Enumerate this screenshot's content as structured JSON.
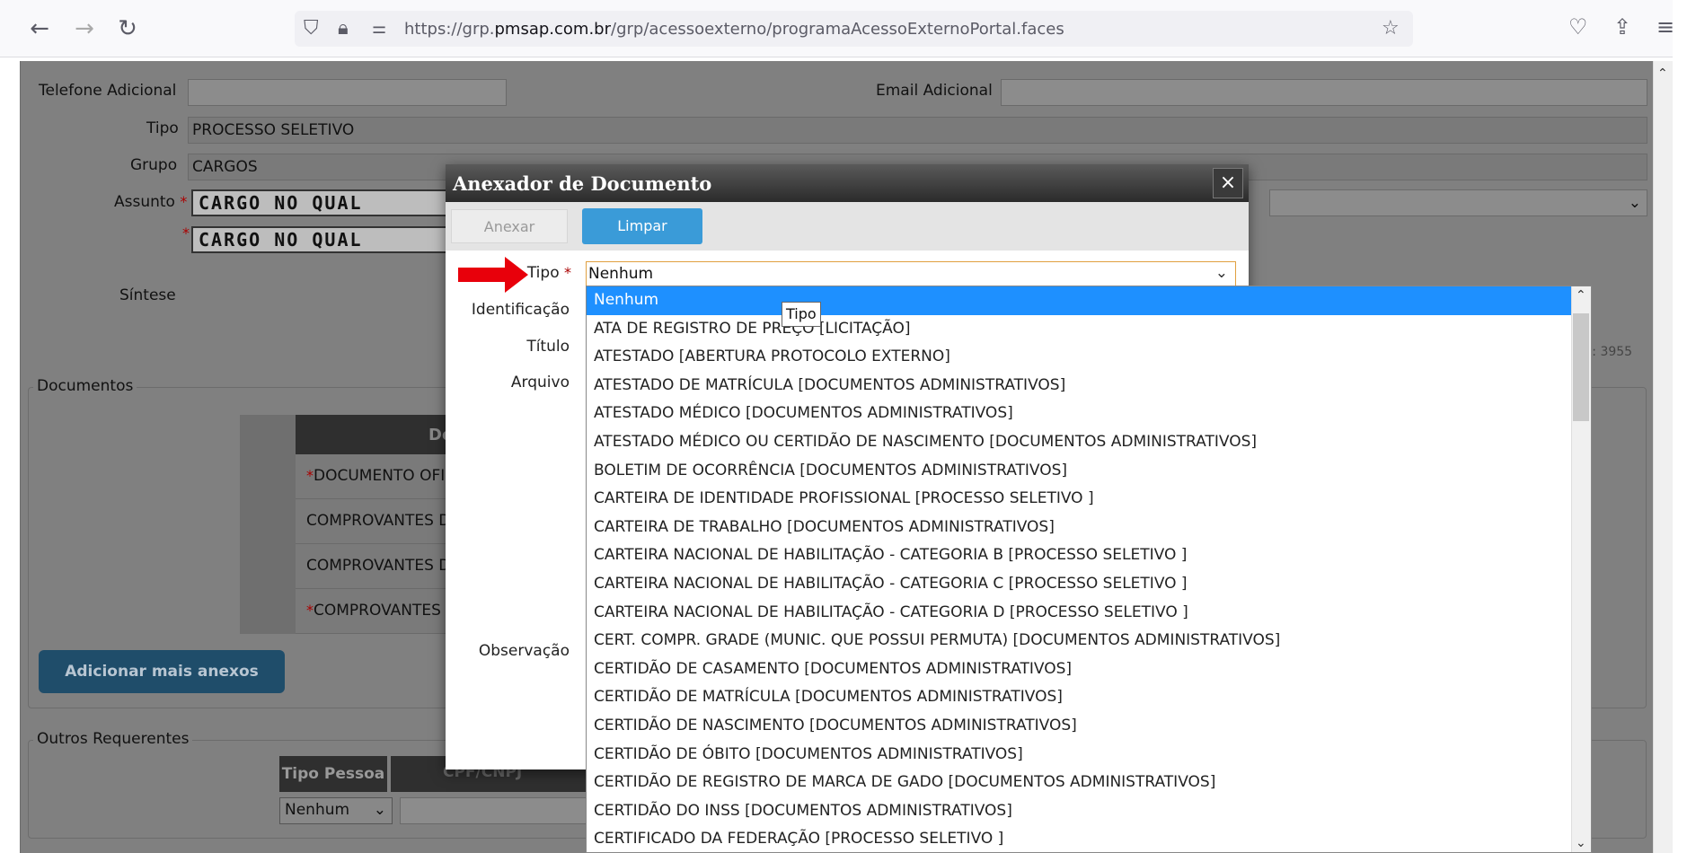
{
  "browser": {
    "url_prefix": "https://grp.",
    "url_domain": "pmsap.com.br",
    "url_path": "/grp/acessoexterno/programaAcessoExternoPortal.faces"
  },
  "form": {
    "telefone_label": "Telefone Adicional",
    "email_label": "Email Adicional",
    "tipo_label": "Tipo",
    "tipo_value": "PROCESSO SELETIVO",
    "grupo_label": "Grupo",
    "grupo_value": "CARGOS",
    "assunto_label": "Assunto",
    "assunto_value": "CARGO NO QUAL",
    "sintese_value": "CARGO NO QUAL",
    "sintese_label": "Síntese",
    "char_counter": "s: 3955"
  },
  "documentos": {
    "legend": "Documentos",
    "header": "De",
    "rows": [
      "DOCUMENTO OFI",
      "COMPROVANTES D",
      "COMPROVANTES D",
      "COMPROVANTES"
    ],
    "row_required": [
      true,
      false,
      false,
      true
    ],
    "add_button": "Adicionar mais anexos"
  },
  "outros": {
    "legend": "Outros Requerentes",
    "col_tipo_pessoa": "Tipo Pessoa",
    "col_cpf": "CPF/CNPJ",
    "tipo_pessoa_value": "Nenhum"
  },
  "dialog": {
    "title": "Anexador de Documento",
    "close": "×",
    "anexar": "Anexar",
    "limpar": "Limpar",
    "tipo_label": "Tipo",
    "tipo_value": "Nenhum",
    "identificacao_label": "Identificação",
    "titulo_label": "Título",
    "arquivo_label": "Arquivo",
    "observacao_label": "Observação",
    "tooltip": "Tipo"
  },
  "dropdown": {
    "selected_index": 0,
    "options": [
      "Nenhum",
      "ATA DE REGISTRO DE PREÇO [LICITAÇÃO]",
      "ATESTADO [ABERTURA PROTOCOLO EXTERNO]",
      "ATESTADO DE MATRÍCULA [DOCUMENTOS ADMINISTRATIVOS]",
      "ATESTADO MÉDICO [DOCUMENTOS ADMINISTRATIVOS]",
      "ATESTADO MÉDICO OU CERTIDÃO DE NASCIMENTO [DOCUMENTOS ADMINISTRATIVOS]",
      "BOLETIM DE OCORRÊNCIA [DOCUMENTOS ADMINISTRATIVOS]",
      "CARTEIRA DE IDENTIDADE PROFISSIONAL [PROCESSO SELETIVO ]",
      "CARTEIRA DE TRABALHO [DOCUMENTOS ADMINISTRATIVOS]",
      "CARTEIRA NACIONAL DE HABILITAÇÃO - CATEGORIA B [PROCESSO SELETIVO ]",
      "CARTEIRA NACIONAL DE HABILITAÇÃO - CATEGORIA C [PROCESSO SELETIVO ]",
      "CARTEIRA NACIONAL DE HABILITAÇÃO - CATEGORIA D [PROCESSO SELETIVO ]",
      "CERT. COMPR. GRADE (MUNIC. QUE POSSUI PERMUTA) [DOCUMENTOS ADMINISTRATIVOS]",
      "CERTIDÃO DE CASAMENTO [DOCUMENTOS ADMINISTRATIVOS]",
      "CERTIDÃO DE MATRÍCULA [DOCUMENTOS ADMINISTRATIVOS]",
      "CERTIDÃO DE NASCIMENTO [DOCUMENTOS ADMINISTRATIVOS]",
      "CERTIDÃO DE ÓBITO [DOCUMENTOS ADMINISTRATIVOS]",
      "CERTIDÃO DE REGISTRO DE MARCA DE GADO [DOCUMENTOS ADMINISTRATIVOS]",
      "CERTIDÃO DO INSS [DOCUMENTOS ADMINISTRATIVOS]",
      "CERTIFICADO DA FEDERAÇÃO [PROCESSO SELETIVO ]"
    ]
  },
  "icons": [
    "back-icon",
    "forward-icon",
    "reload-icon",
    "shield-icon",
    "lock-icon",
    "permissions-icon",
    "bookmark-star-icon",
    "pocket-icon",
    "extensions-icon",
    "menu-icon",
    "paperclip-icon",
    "red-arrow-icon"
  ]
}
